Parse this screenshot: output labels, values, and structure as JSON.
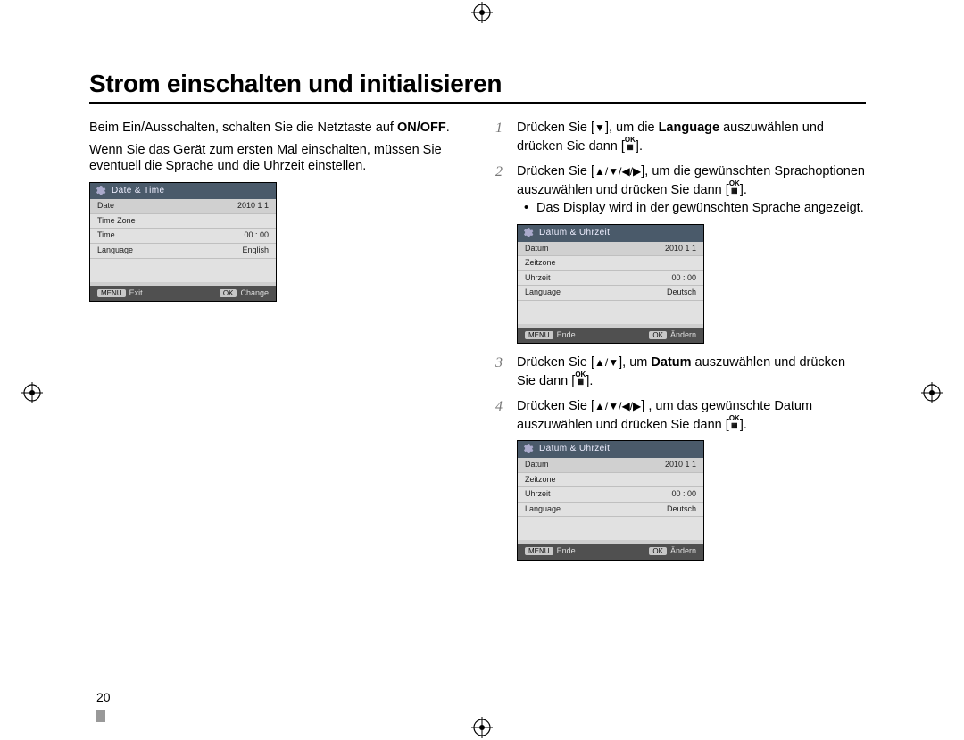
{
  "page_number": "20",
  "heading": "Strom einschalten und initialisieren",
  "left": {
    "p1_a": "Beim Ein/Ausschalten, schalten Sie die Netztaste auf ",
    "p1_bold": "ON/OFF",
    "p1_b": ".",
    "p2": "Wenn Sie das Gerät zum ersten Mal einschalten, müssen Sie eventuell die Sprache und die Uhrzeit einstellen."
  },
  "steps": {
    "s1_a": "Drücken Sie [",
    "s1_arrow": "▼",
    "s1_b": "], um die ",
    "s1_bold": "Language",
    "s1_c": " auszuwählen und drücken Sie dann [",
    "s1_d": "].",
    "s2_a": "Drücken Sie [",
    "s2_arrows": "▲/▼/◀/▶",
    "s2_b": "], um die gewünschten Sprachoptionen auszuwählen und drücken Sie dann [",
    "s2_c": "].",
    "s2_bullet": "Das Display wird in der gewünschten Sprache angezeigt.",
    "s3_a": "Drücken Sie [",
    "s3_arrows": "▲/▼",
    "s3_b": "], um ",
    "s3_bold": "Datum",
    "s3_c": " auszuwählen und drücken Sie dann [",
    "s3_d": "].",
    "s4_a": "Drücken Sie [",
    "s4_arrows": "▲/▼/◀/▶",
    "s4_b": "] , um das gewünschte Datum auszuwählen und drücken Sie dann [",
    "s4_c": "]."
  },
  "ok_icon": {
    "top": "OK",
    "bottom": "▦"
  },
  "screen_en": {
    "title": "Date & Time",
    "rows": [
      {
        "label": "Date",
        "value": "2010  1  1"
      },
      {
        "label": "Time Zone",
        "value": ""
      },
      {
        "label": "Time",
        "value": "00 : 00"
      },
      {
        "label": "Language",
        "value": "English"
      }
    ],
    "menu_btn": "MENU",
    "menu_txt": "Exit",
    "ok_btn": "OK",
    "ok_txt": "Change"
  },
  "screen_de": {
    "title": "Datum & Uhrzeit",
    "rows": [
      {
        "label": "Datum",
        "value": "2010  1  1"
      },
      {
        "label": "Zeitzone",
        "value": ""
      },
      {
        "label": "Uhrzeit",
        "value": "00 : 00"
      },
      {
        "label": "Language",
        "value": "Deutsch"
      }
    ],
    "menu_btn": "MENU",
    "menu_txt": "Ende",
    "ok_btn": "OK",
    "ok_txt": "Ändern"
  }
}
